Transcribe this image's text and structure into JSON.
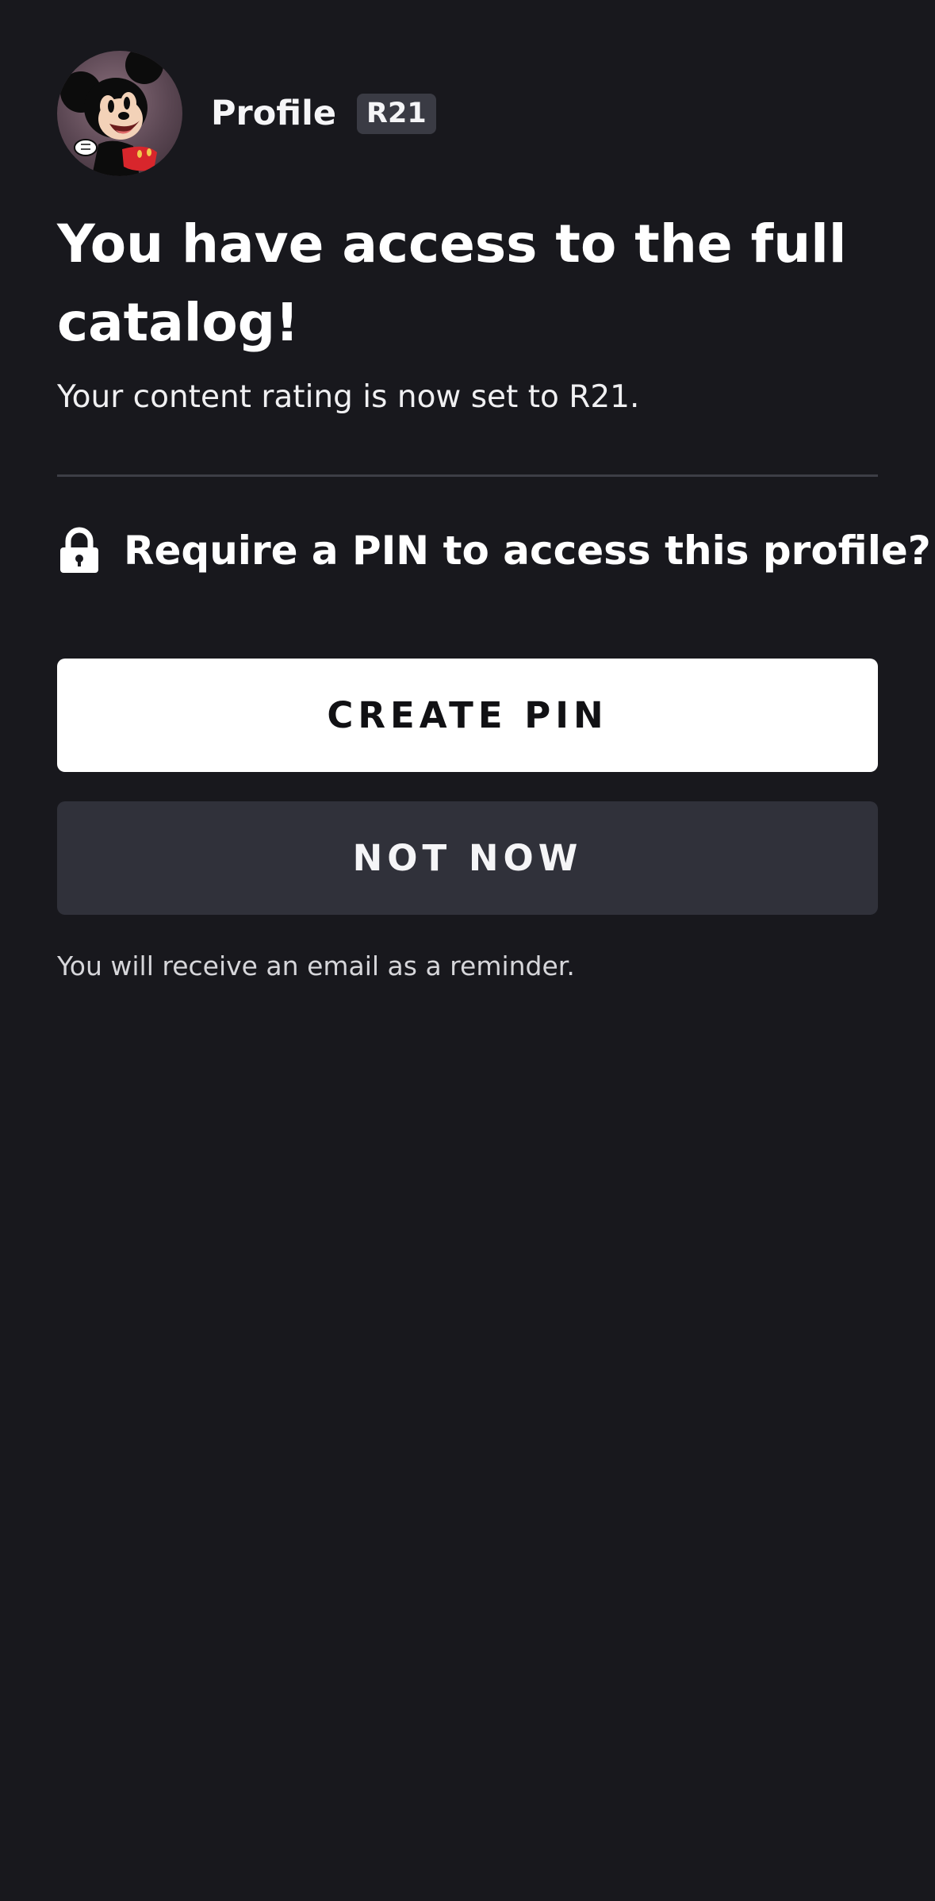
{
  "profile": {
    "name": "Profile",
    "rating_badge": "R21",
    "avatar_icon": "mickey-mouse-avatar"
  },
  "main": {
    "headline": "You have access to the full catalog!",
    "subtext": "Your content rating is now set to R21.",
    "pin_question": "Require a PIN to access this profile?",
    "pin_icon": "lock-icon"
  },
  "buttons": {
    "create_pin": "CREATE PIN",
    "not_now": "NOT NOW"
  },
  "footer": {
    "reminder": "You will receive an email as a reminder."
  },
  "colors": {
    "background": "#18181d",
    "primary_button": "#ffffff",
    "secondary_button": "#30313a",
    "badge": "#3a3b44"
  }
}
